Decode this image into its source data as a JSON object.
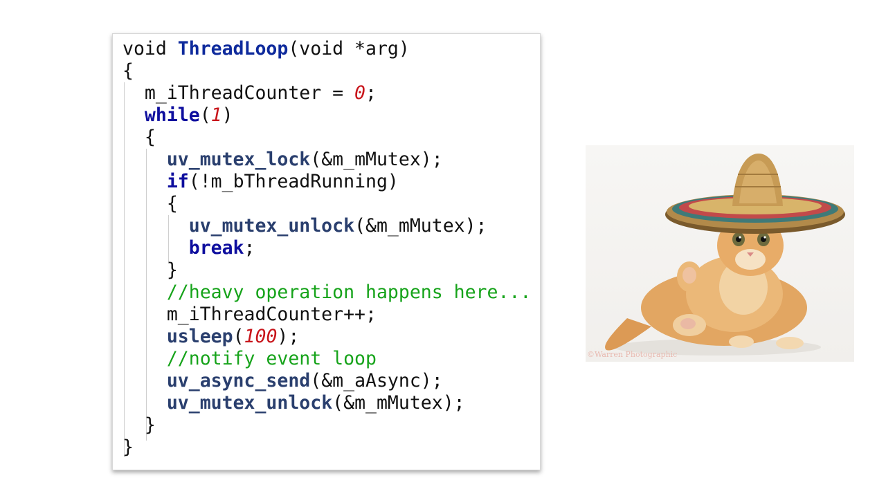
{
  "code": {
    "l1": {
      "t1": "void ",
      "fn": "ThreadLoop",
      "t2": "(void *arg)"
    },
    "l2": {
      "t1": "{"
    },
    "l3": {
      "t1": "  m_iThreadCounter = ",
      "num": "0",
      "t2": ";"
    },
    "l4": {
      "kw": "while",
      "p1": "(",
      "num": "1",
      "p2": ")"
    },
    "l5": {
      "t1": "  {"
    },
    "l6": {
      "api": "uv_mutex_lock",
      "t2": "(&m_mMutex);"
    },
    "l7": {
      "kw": "if",
      "t2": "(!m_bThreadRunning)"
    },
    "l8": {
      "t1": "    {"
    },
    "l9": {
      "api": "uv_mutex_unlock",
      "t2": "(&m_mMutex);"
    },
    "l10": {
      "kw": "break",
      "t2": ";"
    },
    "l11": {
      "t1": "    }"
    },
    "l12": {
      "cm": "//heavy operation happens here..."
    },
    "l13": {
      "t1": "    m_iThreadCounter++;"
    },
    "l14": {
      "api": "usleep",
      "p1": "(",
      "num": "100",
      "t2": ");"
    },
    "l15": {
      "cm": "//notify event loop"
    },
    "l16": {
      "api": "uv_async_send",
      "t2": "(&m_aAsync);"
    },
    "l17": {
      "api": "uv_mutex_unlock",
      "t2": "(&m_mMutex);"
    },
    "l18": {
      "t1": "  }"
    },
    "l19": {
      "t1": "}"
    }
  },
  "photo": {
    "credit": "©Warren Photographic"
  },
  "colors": {
    "function": "#0e2a9c",
    "keyword": "#0e0e9e",
    "api": "#2a3f6e",
    "number": "#c8151b",
    "comment": "#16a31a"
  }
}
